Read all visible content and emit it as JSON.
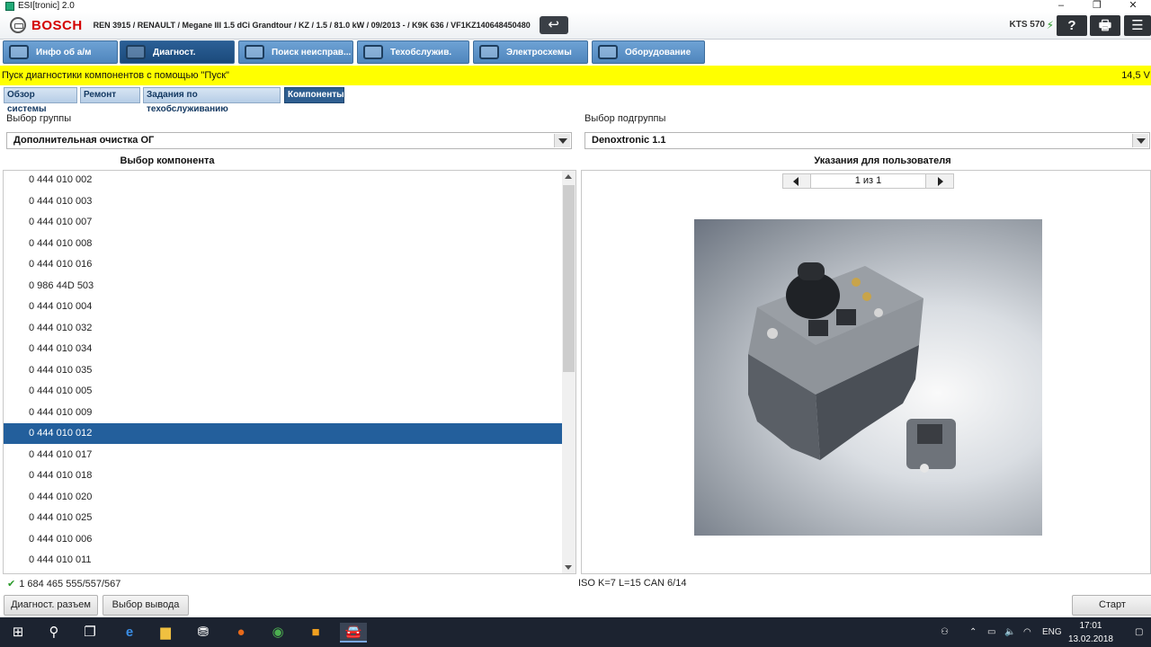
{
  "window": {
    "title": "ESI[tronic] 2.0",
    "controls": [
      "–",
      "❐",
      "✕"
    ]
  },
  "header": {
    "brand": "BOSCH",
    "vehicle": "REN 3915 / RENAULT / Megane III 1.5 dCi Grandtour / KZ / 1.5 / 81.0 kW / 09/2013 - / K9K 636 / VF1KZ140648450480",
    "device": "KTS 570",
    "back_icon": "↩",
    "help_icon": "?",
    "print_icon": "🖶",
    "menu_icon": "☰"
  },
  "main_tabs": [
    {
      "label": "Инфо об а/м",
      "icon": "car-info-icon",
      "active": false
    },
    {
      "label": "Диагност.",
      "icon": "diagnosis-icon",
      "active": true
    },
    {
      "label": "Поиск неисправ...",
      "icon": "troubleshoot-icon",
      "active": false
    },
    {
      "label": "Техобслужив.",
      "icon": "service-icon",
      "active": false
    },
    {
      "label": "Электросхемы",
      "icon": "wiring-icon",
      "active": false
    },
    {
      "label": "Оборудование",
      "icon": "equipment-icon",
      "active": false
    }
  ],
  "status": {
    "message": "Пуск диагностики компонентов с помощью \"Пуск\"",
    "voltage": "14,5 V"
  },
  "sub_tabs": [
    {
      "label": "Обзор системы",
      "active": false
    },
    {
      "label": "Ремонт",
      "active": false
    },
    {
      "label": "Задания по техобслуживанию",
      "active": false
    },
    {
      "label": "Компоненты",
      "active": true
    }
  ],
  "group": {
    "label": "Выбор группы",
    "value": "Дополнительная очистка ОГ"
  },
  "subgroup": {
    "label": "Выбор подгруппы",
    "value": "Denoxtronic 1.1"
  },
  "component_list": {
    "title": "Выбор компонента",
    "selected_index": 12,
    "items": [
      "0 444 010 002",
      "0 444 010 003",
      "0 444 010 007",
      "0 444 010 008",
      "0 444 010 016",
      "0 986 44D 503",
      "0 444 010 004",
      "0 444 010 032",
      "0 444 010 034",
      "0 444 010 035",
      "0 444 010 005",
      "0 444 010 009",
      "0 444 010 012",
      "0 444 010 017",
      "0 444 010 018",
      "0 444 010 020",
      "0 444 010 025",
      "0 444 010 006",
      "0 444 010 011"
    ]
  },
  "user_notes": {
    "title": "Указания для пользователя",
    "pager": "1 из 1"
  },
  "footer": {
    "cable": "1 684 465 555/557/567",
    "protocol": "ISO K=7 L=15 CAN 6/14",
    "buttons": {
      "diag_connector": "Диагност. разъем",
      "output_select": "Выбор вывода",
      "start": "Старт"
    }
  },
  "taskbar": {
    "language": "ENG",
    "time": "17:01",
    "date": "13.02.2018"
  }
}
